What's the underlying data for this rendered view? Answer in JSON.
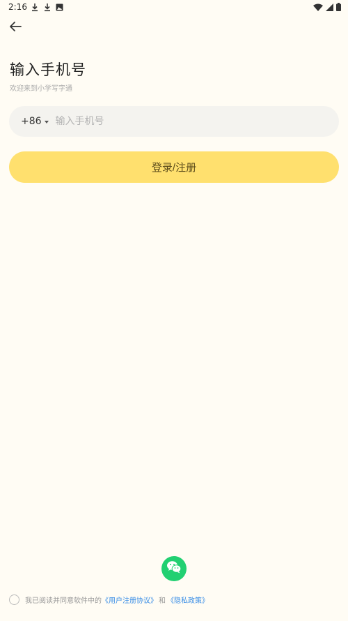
{
  "status_bar": {
    "time": "2:16",
    "left_icons": [
      "download-icon",
      "download-icon",
      "image-icon"
    ],
    "right_icons": [
      "wifi-icon",
      "signal-icon",
      "battery-icon"
    ]
  },
  "header": {
    "back_icon": "arrow-left-icon"
  },
  "main": {
    "title": "输入手机号",
    "subtitle": "欢迎来到小学写字通",
    "country_code": "+86",
    "phone_placeholder": "输入手机号",
    "phone_value": "",
    "login_label": "登录/注册"
  },
  "footer": {
    "wechat_icon": "wechat-icon",
    "agreement_prefix": "我已阅读并同意软件中的",
    "user_agreement": "《用户注册协议》",
    "and": "和",
    "privacy_policy": "《隐私政策》"
  },
  "colors": {
    "background": "#fffcf4",
    "primary_button": "#ffe06e",
    "wechat_green": "#22d072",
    "link": "#3a8ee6"
  }
}
